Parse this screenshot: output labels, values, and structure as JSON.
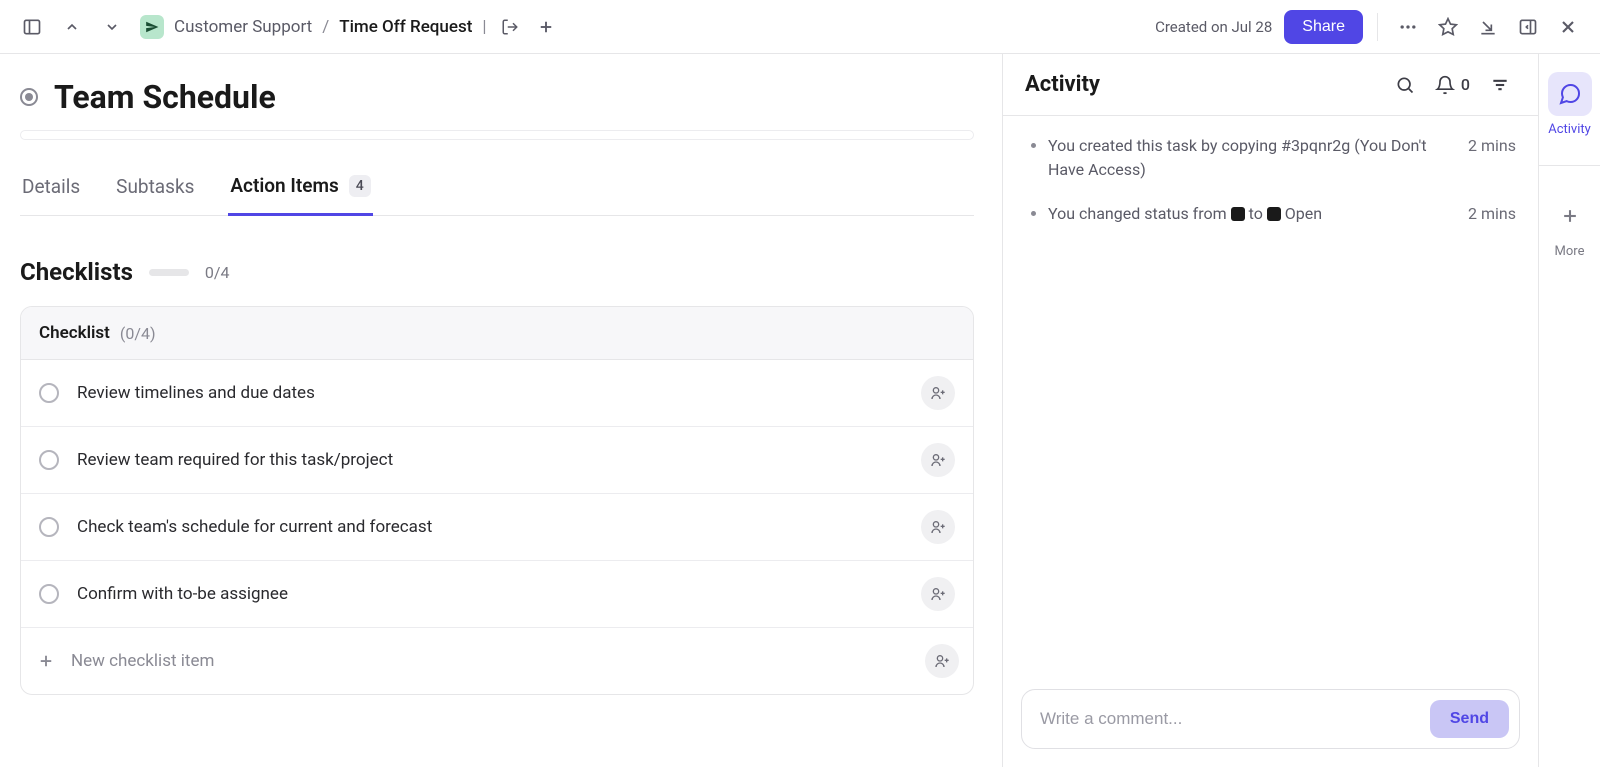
{
  "topbar": {
    "breadcrumb_parent": "Customer Support",
    "breadcrumb_current": "Time Off Request",
    "created_text": "Created on Jul 28",
    "share_label": "Share"
  },
  "task": {
    "title": "Team Schedule"
  },
  "tabs": {
    "details_label": "Details",
    "subtasks_label": "Subtasks",
    "action_items_label": "Action Items",
    "action_items_count": "4"
  },
  "checklists": {
    "section_title": "Checklists",
    "overall_count": "0/4",
    "card_title": "Checklist",
    "card_count": "(0/4)",
    "items": [
      "Review timelines and due dates",
      "Review team required for this task/project",
      "Check team's schedule for current and forecast",
      "Confirm with to-be assignee"
    ],
    "new_item_placeholder": "New checklist item"
  },
  "activity": {
    "title": "Activity",
    "bell_count": "0",
    "entries": [
      {
        "text_before": "You created this task by copying #3pqnr2g (You Don't Have Access)",
        "time": "2 mins",
        "has_status": false
      },
      {
        "text_before": "You changed status from ",
        "text_mid": " to ",
        "text_after": " Open",
        "time": "2 mins",
        "has_status": true
      }
    ],
    "comment_placeholder": "Write a comment...",
    "send_label": "Send"
  },
  "rail": {
    "activity_label": "Activity",
    "more_label": "More"
  }
}
